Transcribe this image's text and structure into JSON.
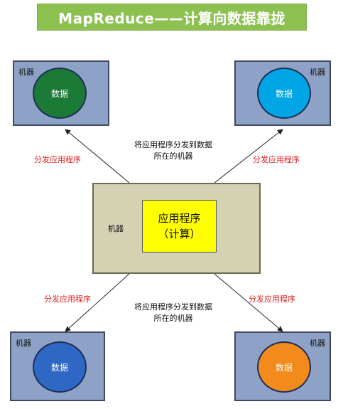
{
  "title": "MapReduce——计算向数据靠拢",
  "machine_label": "机器",
  "data_label": "数据",
  "center": {
    "machine_label": "机器",
    "app_line1": "应用程序",
    "app_line2": "（计算）"
  },
  "arrow_label": "分发应用程序",
  "note_top": {
    "line1": "将应用程序分发到数据",
    "line2": "所在的机器"
  },
  "note_bottom": {
    "line1": "将应用程序分发到数据",
    "line2": "所在的机器"
  },
  "colors": {
    "top_left_data": "#1a7a36",
    "top_right_data": "#00a5e5",
    "bottom_left_data": "#2f67c4",
    "bottom_right_data": "#f28a1c",
    "title_bg": "#8cc152"
  }
}
